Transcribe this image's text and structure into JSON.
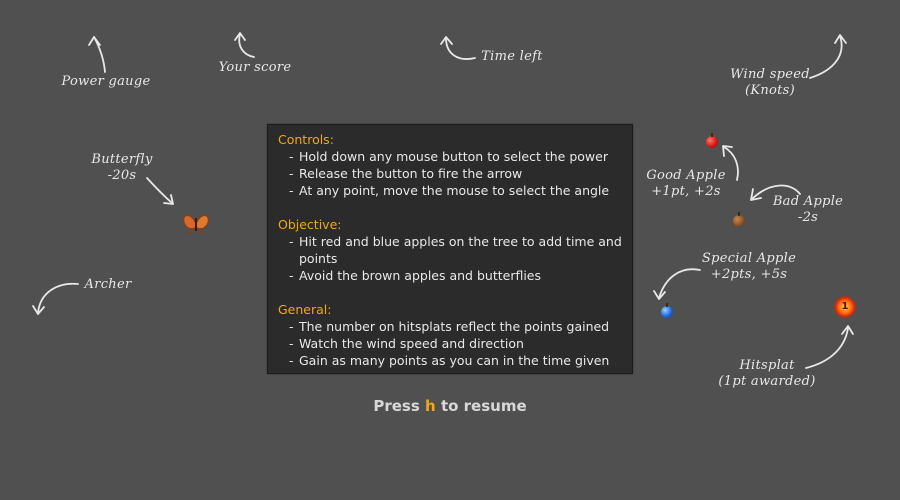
{
  "labels": {
    "power_gauge": "Power gauge",
    "your_score": "Your score",
    "time_left": "Time left",
    "wind_speed_line1": "Wind speed",
    "wind_speed_line2": "(Knots)",
    "butterfly_line1": "Butterfly",
    "butterfly_line2": "-20s",
    "archer": "Archer",
    "good_apple_line1": "Good Apple",
    "good_apple_line2": "+1pt, +2s",
    "bad_apple_line1": "Bad Apple",
    "bad_apple_line2": "-2s",
    "special_apple_line1": "Special Apple",
    "special_apple_line2": "+2pts, +5s",
    "hitsplat_line1": "Hitsplat",
    "hitsplat_line2": "(1pt awarded)"
  },
  "hitsplat_value": "1",
  "instructions": {
    "controls": {
      "title": "Controls:",
      "items": [
        "Hold down any mouse button to select the power",
        "Release the button to fire the arrow",
        "At any point, move the mouse to select the angle"
      ]
    },
    "objective": {
      "title": "Objective:",
      "items": [
        "Hit red and blue apples on the tree to add time and points",
        "Avoid the brown apples and butterflies"
      ]
    },
    "general": {
      "title": "General:",
      "items": [
        "The number on hitsplats reflect the points gained",
        "Watch the wind speed and direction",
        "Gain as many points as you can in the time given"
      ]
    }
  },
  "resume": {
    "prefix": "Press",
    "key": "h",
    "suffix": "to resume"
  },
  "colors": {
    "background": "#505050",
    "panel": "#2b2b2b",
    "accent": "#f0a818",
    "good_apple": "#d81818",
    "bad_apple": "#8a5226",
    "special_apple": "#1c68e0"
  },
  "icons": [
    "butterfly-icon",
    "good-apple-icon",
    "bad-apple-icon",
    "special-apple-icon",
    "hitsplat-icon"
  ]
}
